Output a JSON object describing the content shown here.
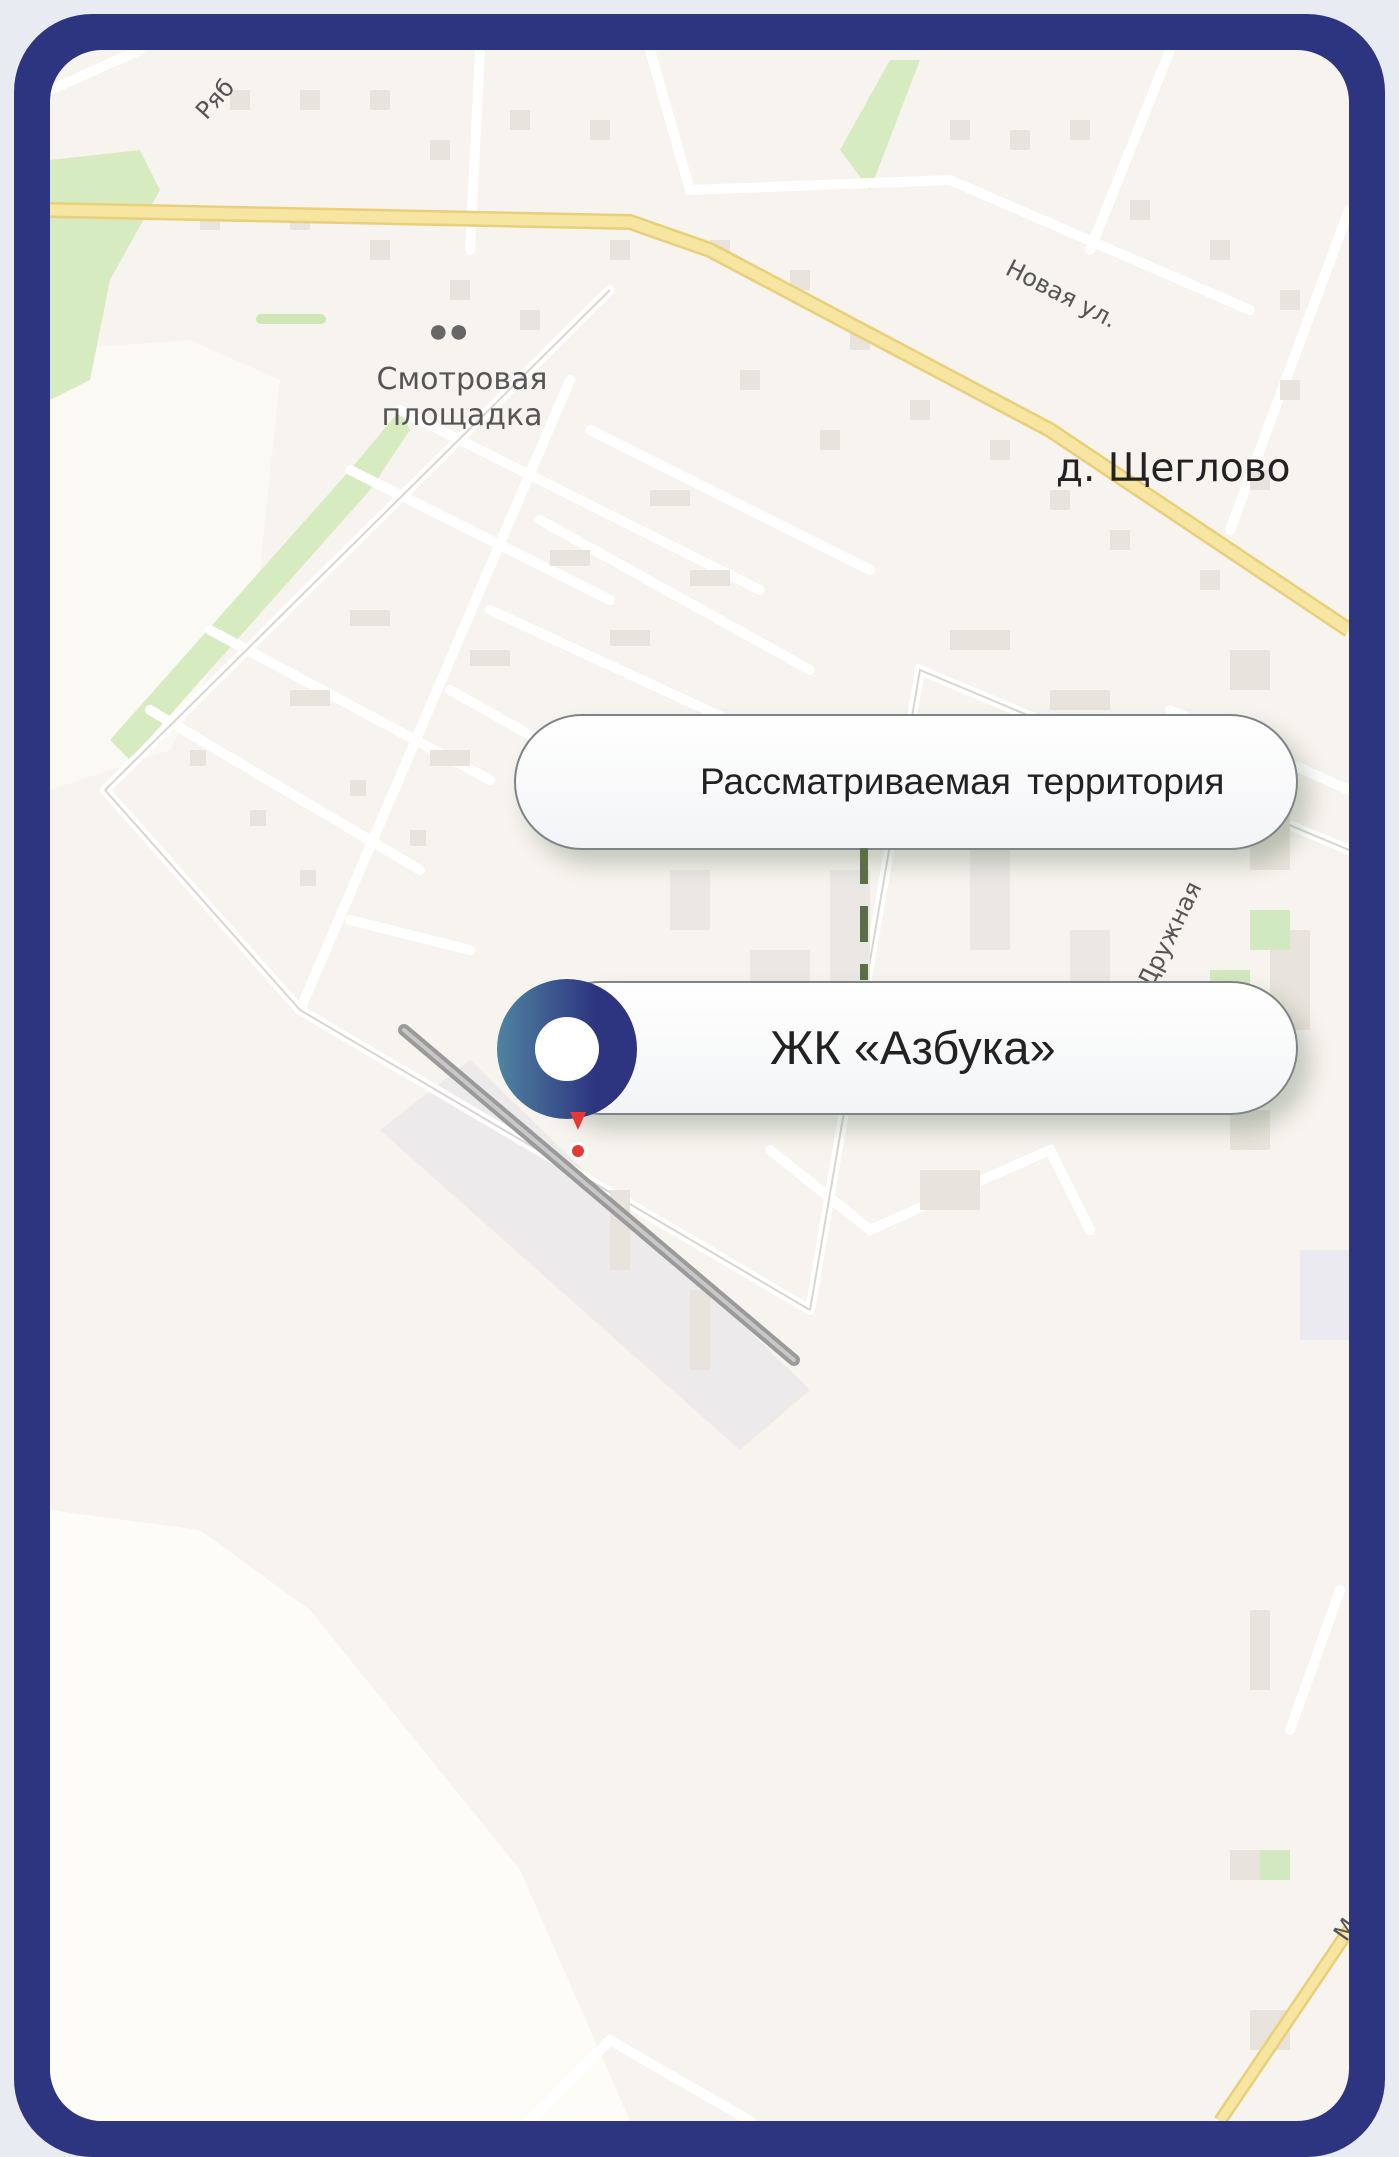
{
  "map": {
    "place_label": "д. Щеглово",
    "poi": {
      "icon": "binoculars-icon",
      "label_line1": "Смотровая",
      "label_line2": "площадка"
    },
    "streets": [
      "Новая ул.",
      "Дружная",
      "Ряб",
      "Ма"
    ],
    "colors": {
      "frame": "#2d3580",
      "map_bg": "#f7f3ee",
      "major_road": "#f6e08f",
      "park": "#d6ebc0",
      "marker_gradient_start": "#4f84a0",
      "marker_gradient_end": "#2d3580",
      "connector": "#5a6e47",
      "pin": "#e53935"
    }
  },
  "callouts": {
    "territory_label": "Рассматриваемая территория",
    "project_label": "ЖК «Азбука»"
  }
}
